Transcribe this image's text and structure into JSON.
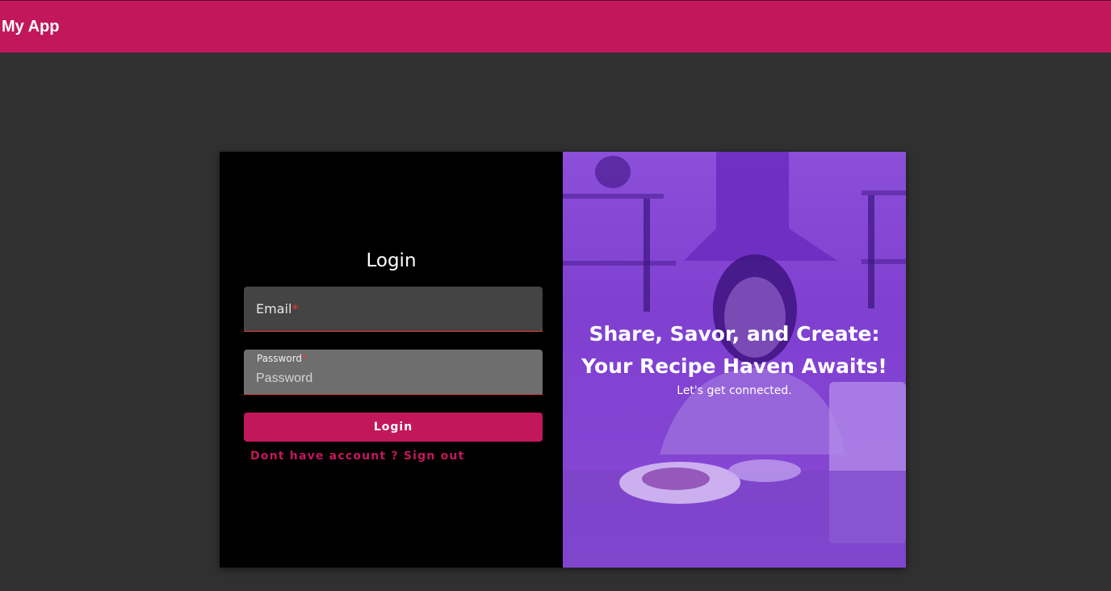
{
  "app": {
    "title": "My App"
  },
  "login": {
    "heading": "Login",
    "email": {
      "label": "Email",
      "required_mark": "*",
      "value": ""
    },
    "password": {
      "label": "Password",
      "required_mark": "*",
      "placeholder": "Password",
      "value": ""
    },
    "submit_label": "Login",
    "signup_link": "Dont have account ? Sign out"
  },
  "hero": {
    "title": "Share, Savor, and Create: Your Recipe Haven Awaits!",
    "subtitle": "Let's get connected.",
    "overlay_color": "#8b4fd8"
  },
  "colors": {
    "accent": "#c2185b",
    "error": "#e53935",
    "background": "#303030"
  }
}
